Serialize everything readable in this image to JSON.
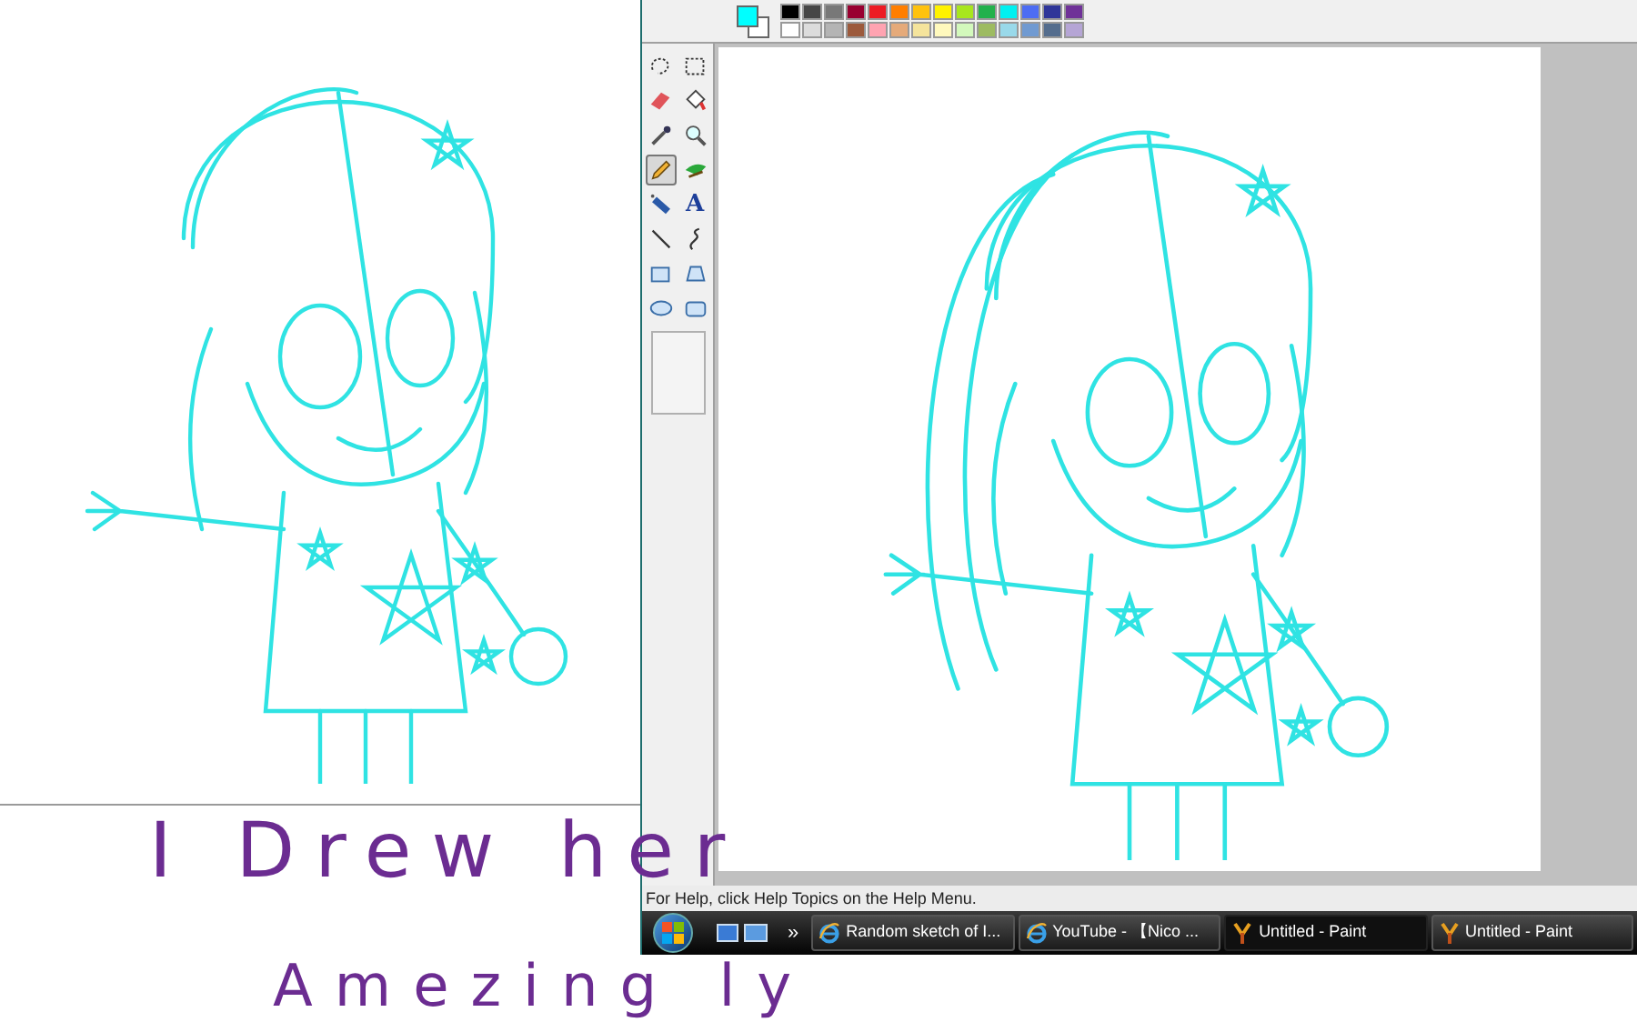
{
  "caption": {
    "lines": [
      "I Drew her",
      "Amezing ly"
    ]
  },
  "paint": {
    "current_colors": [
      {
        "color": "#00ffff"
      },
      {
        "color": "#ffffff"
      }
    ],
    "palette": [
      {
        "color": "#000000"
      },
      {
        "color": "#464646"
      },
      {
        "color": "#787878"
      },
      {
        "color": "#990030"
      },
      {
        "color": "#ed1c24"
      },
      {
        "color": "#ff7e00"
      },
      {
        "color": "#ffc20e"
      },
      {
        "color": "#fff200"
      },
      {
        "color": "#a8e61d"
      },
      {
        "color": "#22b14c"
      },
      {
        "color": "#00f0f0"
      },
      {
        "color": "#4d6df3"
      },
      {
        "color": "#2f3699"
      },
      {
        "color": "#6f3198"
      },
      {
        "color": "#ffffff"
      },
      {
        "color": "#dcdcdc"
      },
      {
        "color": "#b4b4b4"
      },
      {
        "color": "#9c5a3c"
      },
      {
        "color": "#ffa3b1"
      },
      {
        "color": "#e5aa7a"
      },
      {
        "color": "#f5e49c"
      },
      {
        "color": "#fff9bd"
      },
      {
        "color": "#d3f9bc"
      },
      {
        "color": "#9dbb61"
      },
      {
        "color": "#99d9ea"
      },
      {
        "color": "#709ad1"
      },
      {
        "color": "#546d8e"
      },
      {
        "color": "#b5a5d5"
      }
    ],
    "tools": [
      {
        "kind": "free-select",
        "selected": false
      },
      {
        "kind": "select",
        "selected": false
      },
      {
        "kind": "eraser",
        "selected": false
      },
      {
        "kind": "fill",
        "selected": false
      },
      {
        "kind": "picker",
        "selected": false
      },
      {
        "kind": "magnifier",
        "selected": false
      },
      {
        "kind": "pencil",
        "selected": true
      },
      {
        "kind": "brush",
        "selected": false
      },
      {
        "kind": "airbrush",
        "selected": false
      },
      {
        "kind": "text",
        "glyph": "A",
        "selected": false
      },
      {
        "kind": "line",
        "selected": false
      },
      {
        "kind": "curve",
        "selected": false
      },
      {
        "kind": "rectangle",
        "selected": false
      },
      {
        "kind": "polygon",
        "selected": false
      },
      {
        "kind": "ellipse",
        "selected": false
      },
      {
        "kind": "rounded-rectangle",
        "selected": false
      }
    ],
    "status_bar": "For Help, click Help Topics on the Help Menu."
  },
  "taskbar": {
    "chevron": "»",
    "tasks": [
      {
        "kind": "browser",
        "label": "Random sketch of I...",
        "selected": false
      },
      {
        "kind": "browser",
        "label": "YouTube - 【Nico ...",
        "selected": false
      },
      {
        "kind": "paint",
        "label": "Untitled - Paint",
        "selected": true
      },
      {
        "kind": "paint",
        "label": "Untitled - Paint",
        "selected": false
      }
    ]
  }
}
